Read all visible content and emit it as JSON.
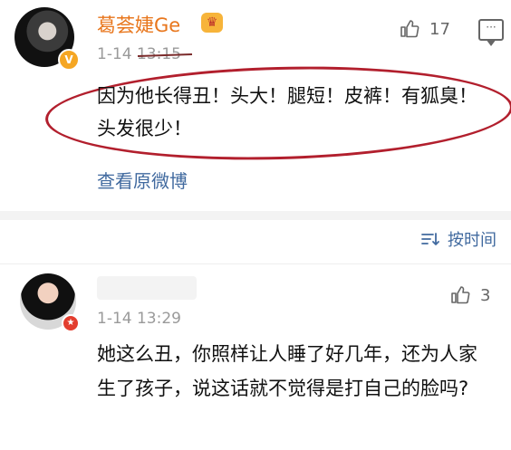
{
  "comment1": {
    "name": "葛荟婕Ge",
    "timestamp": "1-14 13:15",
    "likes": "17",
    "text": "因为他长得丑！头大！腿短！皮裤！有狐臭！头发很少！",
    "link": "查看原微博"
  },
  "sort": {
    "label": "按时间"
  },
  "comment2": {
    "timestamp": "1-14 13:29",
    "likes": "3",
    "text": "她这么丑，你照样让人睡了好几年，还为人家生了孩子，说这话就不觉得是打自己的脸吗?"
  },
  "colors": {
    "username": "#e8761c",
    "link": "#416a9f",
    "annotation": "#b21f2d",
    "muted": "#9a9a9a"
  },
  "icons": {
    "like": "thumbs-up-icon",
    "comment": "comment-icon",
    "sort": "sort-icon",
    "verified": "verified-badge-icon",
    "crown": "crown-icon"
  }
}
